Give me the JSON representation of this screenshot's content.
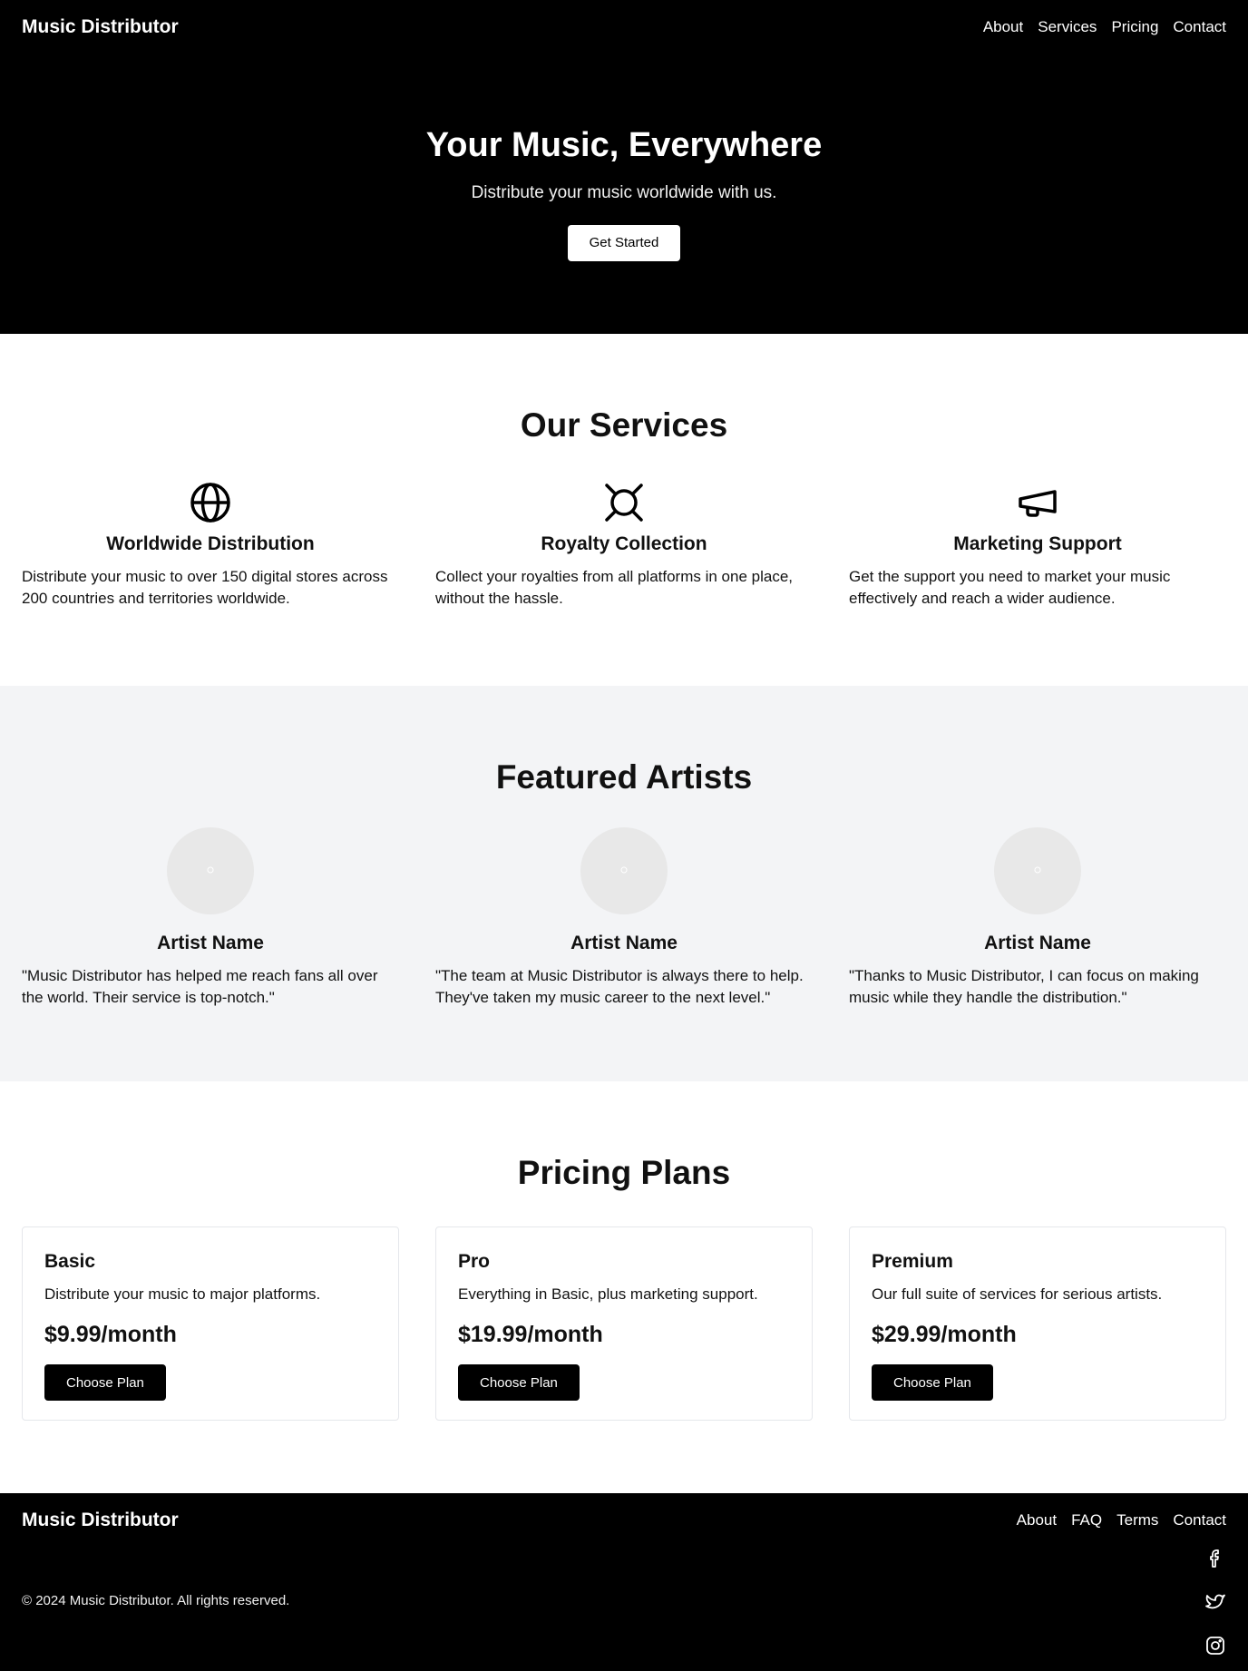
{
  "header": {
    "brand": "Music Distributor",
    "nav": [
      "About",
      "Services",
      "Pricing",
      "Contact"
    ]
  },
  "hero": {
    "title": "Your Music, Everywhere",
    "subtitle": "Distribute your music worldwide with us.",
    "cta": "Get Started"
  },
  "services": {
    "title": "Our Services",
    "items": [
      {
        "icon": "globe-icon",
        "title": "Worldwide Distribution",
        "text": "Distribute your music to over 150 digital stores across 200 countries and territories worldwide."
      },
      {
        "icon": "currency-icon",
        "title": "Royalty Collection",
        "text": "Collect your royalties from all platforms in one place, without the hassle."
      },
      {
        "icon": "megaphone-icon",
        "title": "Marketing Support",
        "text": "Get the support you need to market your music effectively and reach a wider audience."
      }
    ]
  },
  "artists": {
    "title": "Featured Artists",
    "items": [
      {
        "name": "Artist Name",
        "quote": "\"Music Distributor has helped me reach fans all over the world. Their service is top-notch.\""
      },
      {
        "name": "Artist Name",
        "quote": "\"The team at Music Distributor is always there to help. They've taken my music career to the next level.\""
      },
      {
        "name": "Artist Name",
        "quote": "\"Thanks to Music Distributor, I can focus on making music while they handle the distribution.\""
      }
    ]
  },
  "pricing": {
    "title": "Pricing Plans",
    "plans": [
      {
        "name": "Basic",
        "desc": "Distribute your music to major platforms.",
        "price": "$9.99/month",
        "button": "Choose Plan"
      },
      {
        "name": "Pro",
        "desc": "Everything in Basic, plus marketing support.",
        "price": "$19.99/month",
        "button": "Choose Plan"
      },
      {
        "name": "Premium",
        "desc": "Our full suite of services for serious artists.",
        "price": "$29.99/month",
        "button": "Choose Plan"
      }
    ]
  },
  "footer": {
    "brand": "Music Distributor",
    "links": [
      "About",
      "FAQ",
      "Terms",
      "Contact"
    ],
    "copyright": "© 2024 Music Distributor. All rights reserved.",
    "social": [
      "facebook-icon",
      "twitter-icon",
      "instagram-icon"
    ]
  },
  "colors": {
    "dark": "#000000",
    "light_section": "#f3f4f6",
    "avatar": "#e8e8e8"
  }
}
